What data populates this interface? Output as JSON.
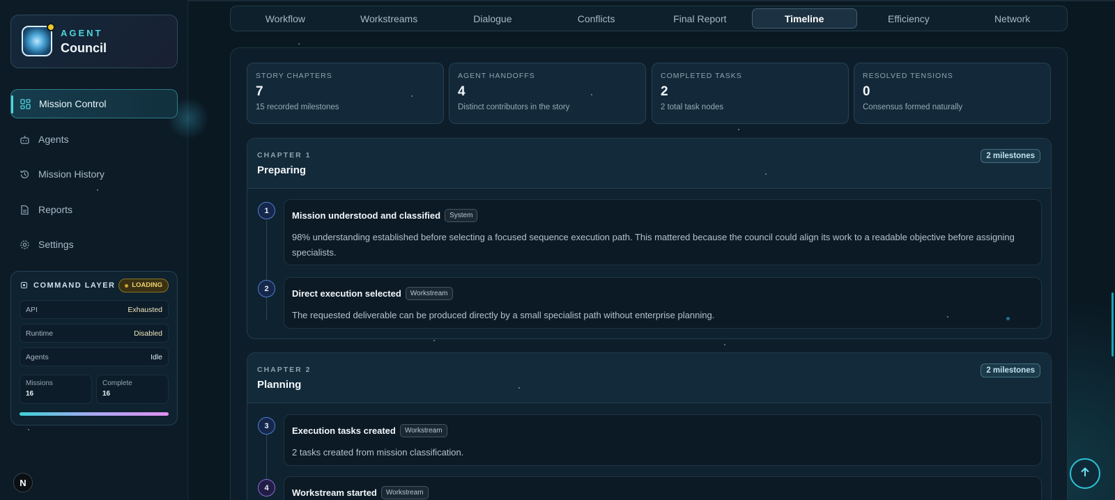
{
  "brand": {
    "top": "AGENT",
    "name": "Council"
  },
  "nav": [
    {
      "label": "Mission Control",
      "icon": "dashboard-icon",
      "active": true
    },
    {
      "label": "Agents",
      "icon": "robot-icon",
      "active": false
    },
    {
      "label": "Mission History",
      "icon": "history-icon",
      "active": false
    },
    {
      "label": "Reports",
      "icon": "document-icon",
      "active": false
    },
    {
      "label": "Settings",
      "icon": "gear-icon",
      "active": false
    }
  ],
  "command_layer": {
    "title": "COMMAND LAYER",
    "status": "LOADING",
    "rows": [
      {
        "key": "API",
        "value": "Exhausted"
      },
      {
        "key": "Runtime",
        "value": "Disabled"
      },
      {
        "key": "Agents",
        "value": "Idle"
      }
    ],
    "stats": [
      {
        "key": "Missions",
        "value": "16"
      },
      {
        "key": "Complete",
        "value": "16"
      }
    ]
  },
  "footer_badge": "N",
  "tabs": [
    {
      "label": "Workflow",
      "active": false
    },
    {
      "label": "Workstreams",
      "active": false
    },
    {
      "label": "Dialogue",
      "active": false
    },
    {
      "label": "Conflicts",
      "active": false
    },
    {
      "label": "Final Report",
      "active": false
    },
    {
      "label": "Timeline",
      "active": true
    },
    {
      "label": "Efficiency",
      "active": false
    },
    {
      "label": "Network",
      "active": false
    }
  ],
  "stats": [
    {
      "label": "STORY CHAPTERS",
      "value": "7",
      "sub": "15 recorded milestones"
    },
    {
      "label": "AGENT HANDOFFS",
      "value": "4",
      "sub": "Distinct contributors in the story"
    },
    {
      "label": "COMPLETED TASKS",
      "value": "2",
      "sub": "2 total task nodes"
    },
    {
      "label": "RESOLVED TENSIONS",
      "value": "0",
      "sub": "Consensus formed naturally"
    }
  ],
  "chapters": [
    {
      "number": "CHAPTER 1",
      "title": "Preparing",
      "badge": "2 milestones",
      "milestones": [
        {
          "step": "1",
          "title": "Mission understood and classified",
          "tag": "System",
          "desc": "98% understanding established before selecting a focused sequence execution path. This mattered because the council could align its work to a readable objective before assigning specialists."
        },
        {
          "step": "2",
          "title": "Direct execution selected",
          "tag": "Workstream",
          "desc": "The requested deliverable can be produced directly by a small specialist path without enterprise planning."
        }
      ]
    },
    {
      "number": "CHAPTER 2",
      "title": "Planning",
      "badge": "2 milestones",
      "milestones": [
        {
          "step": "3",
          "title": "Execution tasks created",
          "tag": "Workstream",
          "desc": "2 tasks created from mission classification."
        },
        {
          "step": "4",
          "title": "Workstream started",
          "tag": "Workstream",
          "desc": ""
        }
      ]
    }
  ]
}
